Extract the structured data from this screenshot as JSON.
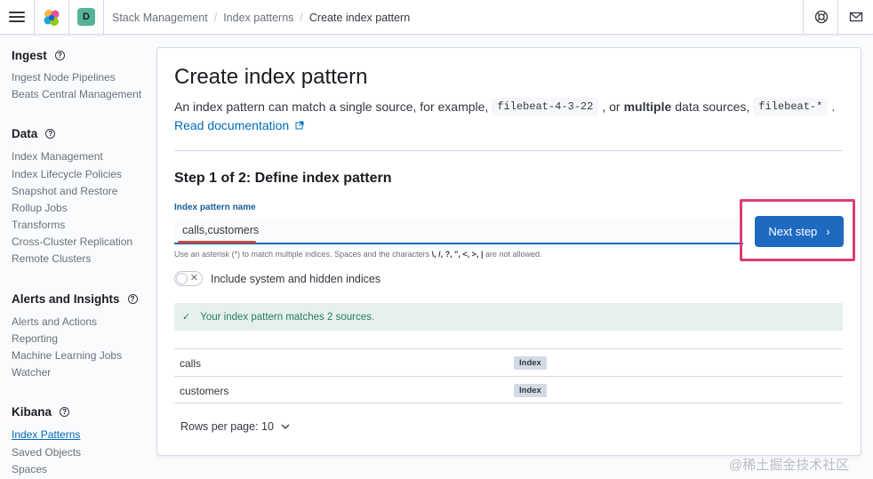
{
  "header": {
    "space_initial": "D",
    "breadcrumbs": [
      "Stack Management",
      "Index patterns",
      "Create index pattern"
    ]
  },
  "sidebar": {
    "groups": [
      {
        "title": "Ingest",
        "items": [
          "Ingest Node Pipelines",
          "Beats Central Management"
        ]
      },
      {
        "title": "Data",
        "items": [
          "Index Management",
          "Index Lifecycle Policies",
          "Snapshot and Restore",
          "Rollup Jobs",
          "Transforms",
          "Cross-Cluster Replication",
          "Remote Clusters"
        ]
      },
      {
        "title": "Alerts and Insights",
        "items": [
          "Alerts and Actions",
          "Reporting",
          "Machine Learning Jobs",
          "Watcher"
        ]
      },
      {
        "title": "Kibana",
        "items": [
          "Index Patterns",
          "Saved Objects",
          "Spaces"
        ]
      }
    ],
    "active_item": "Index Patterns"
  },
  "main": {
    "title": "Create index pattern",
    "description": {
      "part1": "An index pattern can match a single source, for example,",
      "code1": "filebeat-4-3-22",
      "part2": ", or",
      "bold": "multiple",
      "part3": "data sources,",
      "code2": "filebeat-*",
      "part4": "."
    },
    "read_doc": "Read documentation",
    "step_title": "Step 1 of 2: Define index pattern",
    "field_label": "Index pattern name",
    "field_value": "calls,customers",
    "help_text_pre": "Use an asterisk (*) to match multiple indices. Spaces and the characters",
    "help_text_chars": "\\, /, ?, \", <, >, |",
    "help_text_post": "are not allowed.",
    "toggle_label": "Include system and hidden indices",
    "toggle_on": false,
    "match_callout": "Your index pattern matches 2 sources.",
    "matches": [
      {
        "name": "calls",
        "type": "Index"
      },
      {
        "name": "customers",
        "type": "Index"
      }
    ],
    "rows_per_page": "Rows per page: 10",
    "next_button": "Next step"
  },
  "watermark": "@稀土掘金技术社区",
  "colors": {
    "primary": "#1f6ac1",
    "link": "#006bb8",
    "highlight": "#dd3c76",
    "success_bg": "#e6f1ee",
    "success_text": "#257e5b"
  }
}
